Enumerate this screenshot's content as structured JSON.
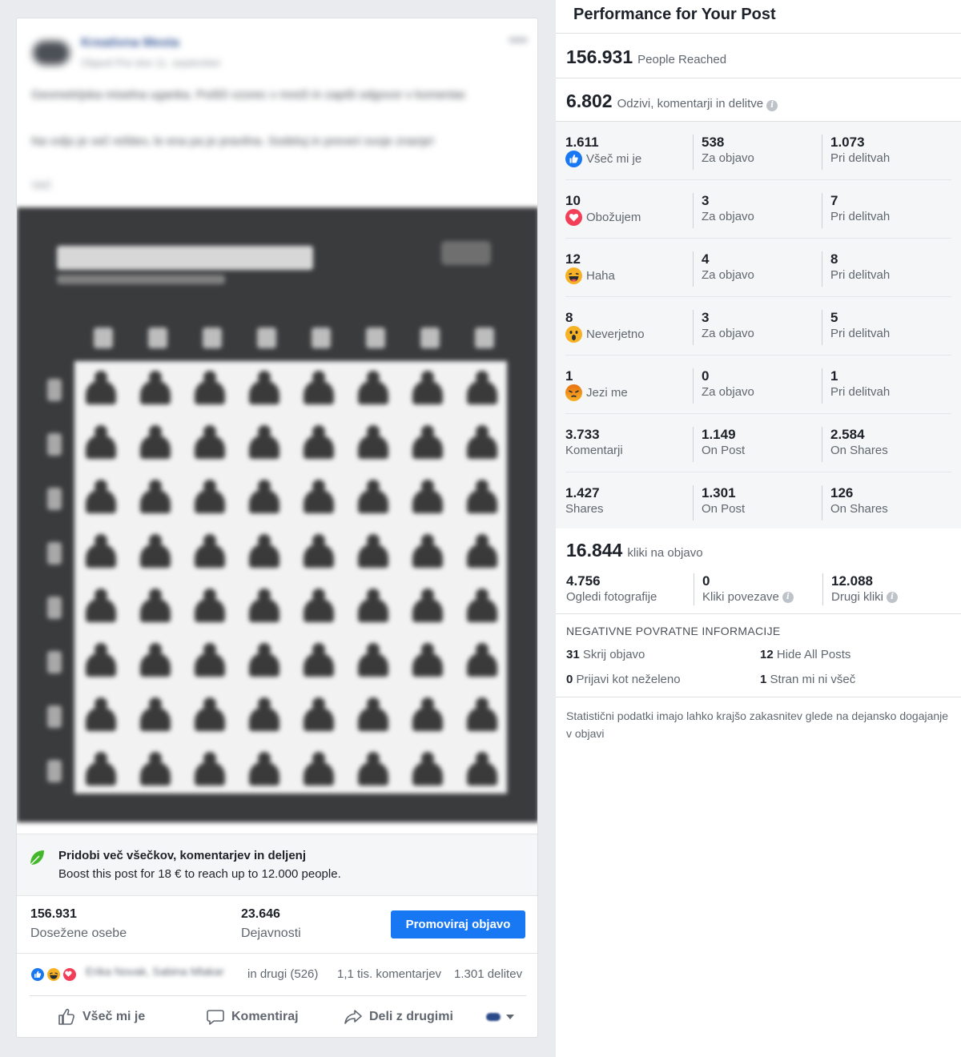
{
  "post": {
    "page_name": "Kreativna Mesta",
    "post_meta": "Objavil Pixi dne 11. september",
    "text_line1": "Geometrijska miselna uganka. Poišči vzorec v mreži in zapiši odgovor v komentar.",
    "text_line2": "Na voljo je več rešitev, le ena pa je pravilna. Sodeluj in preveri svoje znanje!",
    "more_link": "Več",
    "image_title": "MAGIBRADNA IGRA",
    "image_subtitle": "Poišči pravilno pot",
    "column_letters": [
      "A",
      "B",
      "C",
      "D",
      "E",
      "F",
      "G",
      "H"
    ],
    "row_numbers": [
      "1",
      "2",
      "3",
      "4",
      "5",
      "6",
      "7",
      "8"
    ]
  },
  "boost": {
    "title": "Pridobi več všečkov, komentarjev in deljenj",
    "text": "Boost this post for 18 € to reach up to 12.000 people."
  },
  "stats": {
    "reach_value": "156.931",
    "reach_label": "Dosežene osebe",
    "engagement_value": "23.646",
    "engagement_label": "Dejavnosti",
    "promote_button": "Promoviraj objavo"
  },
  "reactions_bar": {
    "names": "Erika Novak, Sabina Mlakar",
    "others": "in drugi (526)",
    "comments": "1,1 tis. komentarjev",
    "shares": "1.301 delitev"
  },
  "actions": {
    "like": "Všeč mi je",
    "comment": "Komentiraj",
    "share": "Deli z drugimi"
  },
  "performance": {
    "title": "Performance for Your Post",
    "people_reached_value": "156.931",
    "people_reached_label": "People Reached",
    "engagement_value": "6.802",
    "engagement_label": "Odzivi, komentarji in delitve",
    "rows": [
      {
        "total": "1.611",
        "label": "Všeč mi je",
        "icon": "like-icon",
        "on_post": "538",
        "on_post_label": "Za objavo",
        "on_shares": "1.073",
        "on_shares_label": "Pri delitvah"
      },
      {
        "total": "10",
        "label": "Obožujem",
        "icon": "love-icon",
        "on_post": "3",
        "on_post_label": "Za objavo",
        "on_shares": "7",
        "on_shares_label": "Pri delitvah"
      },
      {
        "total": "12",
        "label": "Haha",
        "icon": "haha-icon",
        "on_post": "4",
        "on_post_label": "Za objavo",
        "on_shares": "8",
        "on_shares_label": "Pri delitvah"
      },
      {
        "total": "8",
        "label": "Neverjetno",
        "icon": "wow-icon",
        "on_post": "3",
        "on_post_label": "Za objavo",
        "on_shares": "5",
        "on_shares_label": "Pri delitvah"
      },
      {
        "total": "1",
        "label": "Jezi me",
        "icon": "angry-icon",
        "on_post": "0",
        "on_post_label": "Za objavo",
        "on_shares": "1",
        "on_shares_label": "Pri delitvah"
      },
      {
        "total": "3.733",
        "label": "Komentarji",
        "icon": "",
        "on_post": "1.149",
        "on_post_label": "On Post",
        "on_shares": "2.584",
        "on_shares_label": "On Shares"
      },
      {
        "total": "1.427",
        "label": "Shares",
        "icon": "",
        "on_post": "1.301",
        "on_post_label": "On Post",
        "on_shares": "126",
        "on_shares_label": "On Shares"
      }
    ],
    "clicks_value": "16.844",
    "clicks_label": "kliki na objavo",
    "photo_views_value": "4.756",
    "photo_views_label": "Ogledi fotografije",
    "link_clicks_value": "0",
    "link_clicks_label": "Kliki povezave",
    "other_clicks_value": "12.088",
    "other_clicks_label": "Drugi kliki",
    "negative_title": "NEGATIVNE POVRATNE INFORMACIJE",
    "hide_post_value": "31",
    "hide_post_label": "Skrij objavo",
    "hide_all_value": "12",
    "hide_all_label": "Hide All Posts",
    "spam_value": "0",
    "spam_label": "Prijavi kot neželeno",
    "unlike_value": "1",
    "unlike_label": "Stran mi ni všeč",
    "note": "Statistični podatki imajo lahko krajšo zakasnitev glede na dejansko dogajanje v objavi"
  },
  "colors": {
    "accent": "#1877f2",
    "like": "#1877f2",
    "love": "#f33e58",
    "haha": "#f7b125",
    "angry": "#e9710f",
    "boost_leaf": "#42b72a"
  }
}
